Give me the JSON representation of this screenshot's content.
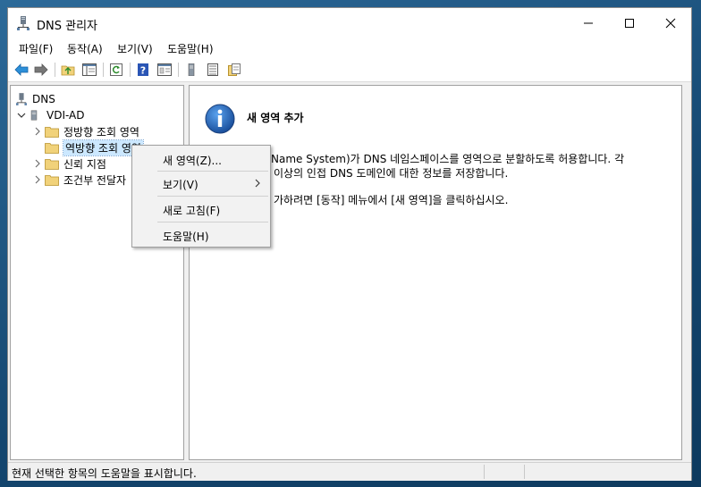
{
  "window": {
    "title": "DNS 관리자"
  },
  "menu": [
    {
      "label": "파일(F)"
    },
    {
      "label": "동작(A)"
    },
    {
      "label": "보기(V)"
    },
    {
      "label": "도움말(H)"
    }
  ],
  "tree": {
    "root": "DNS",
    "server": "VDI-AD",
    "children": [
      {
        "label": "정방향 조회 영역"
      },
      {
        "label": "역방향 조회 영역",
        "selected": true
      },
      {
        "label": "신뢰 지점"
      },
      {
        "label": "조건부 전달자"
      }
    ]
  },
  "detail": {
    "title": "새 영역 추가",
    "line1": "Name System)가 DNS 네임스페이스를 영역으로 분할하도록 허용합니다. 각",
    "line2": "이상의 인접 DNS 도메인에 대한 정보를 저장합니다.",
    "line3": "가하려면 [동작] 메뉴에서 [새 영역]을 클릭하십시오."
  },
  "context_menu": [
    {
      "label": "새 영역(Z)..."
    },
    {
      "label": "보기(V)",
      "submenu": true
    },
    {
      "label": "새로 고침(F)"
    },
    {
      "label": "도움말(H)"
    }
  ],
  "status": {
    "text": "현재 선택한 항목의 도움말을 표시합니다."
  },
  "colors": {
    "selection": "#cce8ff",
    "info_blue": "#1a66c2",
    "folder": "#f1d27a"
  },
  "icons": [
    "dns-app-icon",
    "back-icon",
    "forward-icon",
    "up-folder-icon",
    "show-tree-icon",
    "refresh-icon",
    "help-icon",
    "properties-icon",
    "server-icon",
    "list-icon",
    "export-icon",
    "info-icon",
    "folder-icon"
  ]
}
